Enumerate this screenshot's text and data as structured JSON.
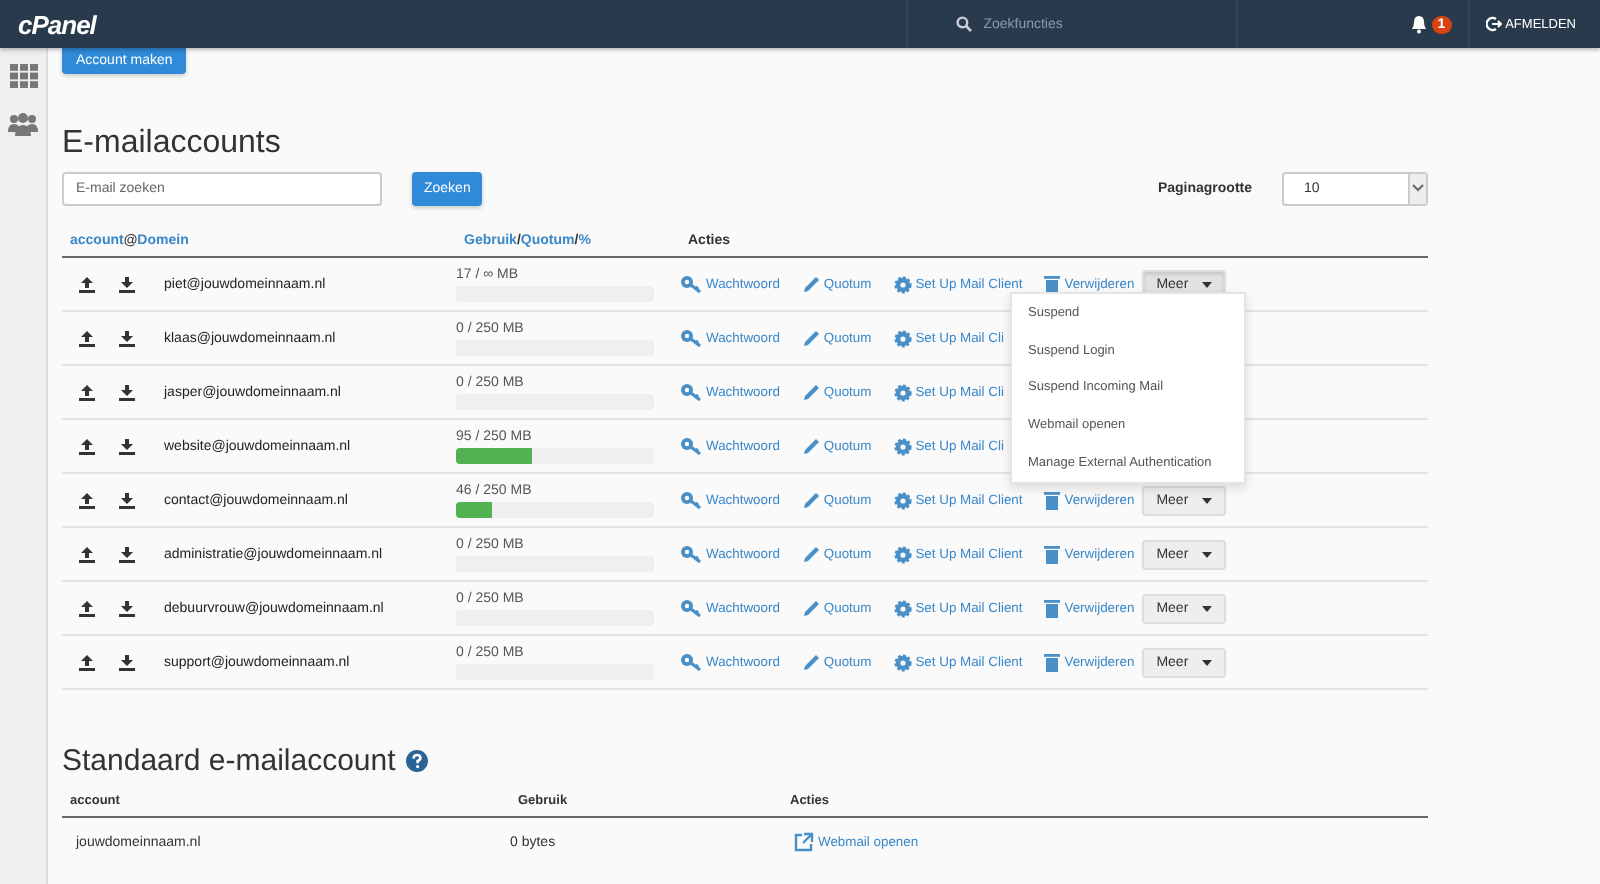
{
  "topbar": {
    "logo": "cPanel",
    "search_placeholder": "Zoekfuncties",
    "notification_count": "1",
    "logout": "AFMELDEN"
  },
  "create_button": "Account maken",
  "title": "E-mailaccounts",
  "search": {
    "placeholder": "E-mail zoeken",
    "button": "Zoeken"
  },
  "page_size": {
    "label": "Paginagrootte",
    "value": "10"
  },
  "columns": [
    {
      "parts": [
        "account",
        " @ ",
        "Domein"
      ],
      "kind": "sort"
    },
    {
      "parts": [
        "Gebruik",
        " / ",
        "Quotum",
        " / ",
        "%"
      ],
      "kind": "sort"
    },
    {
      "parts": [
        "Acties"
      ],
      "kind": "plain"
    }
  ],
  "rows": [
    {
      "email": "piet@jouwdomeinnaam.nl",
      "usage": "17 / ∞ MB",
      "menu_open": true,
      "actions": [
        {
          "kind": "password",
          "label": "Wachtwoord"
        },
        {
          "kind": "quota",
          "label": "Quotum"
        },
        {
          "kind": "client",
          "label": "Set Up Mail Client"
        },
        {
          "kind": "delete",
          "label": "Verwijderen"
        },
        {
          "kind": "more",
          "label": "Meer"
        }
      ]
    },
    {
      "email": "klaas@jouwdomeinnaam.nl",
      "usage": "0 / 250 MB",
      "actions": [
        {
          "kind": "password",
          "label": "Wachtwoord"
        },
        {
          "kind": "quota",
          "label": "Quotum"
        },
        {
          "kind": "client",
          "label": "Set Up Mail Cli"
        }
      ]
    },
    {
      "email": "jasper@jouwdomeinnaam.nl",
      "usage": "0 / 250 MB",
      "actions": [
        {
          "kind": "password",
          "label": "Wachtwoord"
        },
        {
          "kind": "quota",
          "label": "Quotum"
        },
        {
          "kind": "client",
          "label": "Set Up Mail Cli"
        }
      ]
    },
    {
      "email": "website@jouwdomeinnaam.nl",
      "usage": "95 / 250 MB",
      "level": 0.38,
      "actions": [
        {
          "kind": "password",
          "label": "Wachtwoord"
        },
        {
          "kind": "quota",
          "label": "Quotum"
        },
        {
          "kind": "client",
          "label": "Set Up Mail Cli"
        }
      ]
    },
    {
      "email": "contact@jouwdomeinnaam.nl",
      "usage": "46 / 250 MB",
      "level": 0.18,
      "menu_open": false,
      "actions": [
        {
          "kind": "password",
          "label": "Wachtwoord"
        },
        {
          "kind": "quota",
          "label": "Quotum"
        },
        {
          "kind": "client",
          "label": "Set Up Mail Client"
        },
        {
          "kind": "delete",
          "label": "Verwijderen"
        },
        {
          "kind": "more",
          "label": "Meer"
        }
      ]
    },
    {
      "email": "administratie@jouwdomeinnaam.nl",
      "usage": "0 / 250 MB",
      "menu_open": false,
      "actions": [
        {
          "kind": "password",
          "label": "Wachtwoord"
        },
        {
          "kind": "quota",
          "label": "Quotum"
        },
        {
          "kind": "client",
          "label": "Set Up Mail Client"
        },
        {
          "kind": "delete",
          "label": "Verwijderen"
        },
        {
          "kind": "more",
          "label": "Meer"
        }
      ]
    },
    {
      "email": "debuurvrouw@jouwdomeinnaam.nl",
      "usage": "0 / 250 MB",
      "menu_open": false,
      "actions": [
        {
          "kind": "password",
          "label": "Wachtwoord"
        },
        {
          "kind": "quota",
          "label": "Quotum"
        },
        {
          "kind": "client",
          "label": "Set Up Mail Client"
        },
        {
          "kind": "delete",
          "label": "Verwijderen"
        },
        {
          "kind": "more",
          "label": "Meer"
        }
      ]
    },
    {
      "email": "support@jouwdomeinnaam.nl",
      "usage": "0 / 250 MB",
      "menu_open": false,
      "actions": [
        {
          "kind": "password",
          "label": "Wachtwoord"
        },
        {
          "kind": "quota",
          "label": "Quotum"
        },
        {
          "kind": "client",
          "label": "Set Up Mail Client"
        },
        {
          "kind": "delete",
          "label": "Verwijderen"
        },
        {
          "kind": "more",
          "label": "Meer"
        }
      ]
    }
  ],
  "menu": [
    "Suspend",
    "Suspend Login",
    "Suspend Incoming Mail",
    "Webmail openen",
    "Manage External Authentication"
  ],
  "default_section": {
    "title": "Standaard e-mailaccount",
    "columns": [
      "account",
      "Gebruik",
      "Acties"
    ],
    "row": {
      "account": "jouwdomeinnaam.nl",
      "usage": "0 bytes",
      "action": "Webmail openen"
    }
  }
}
